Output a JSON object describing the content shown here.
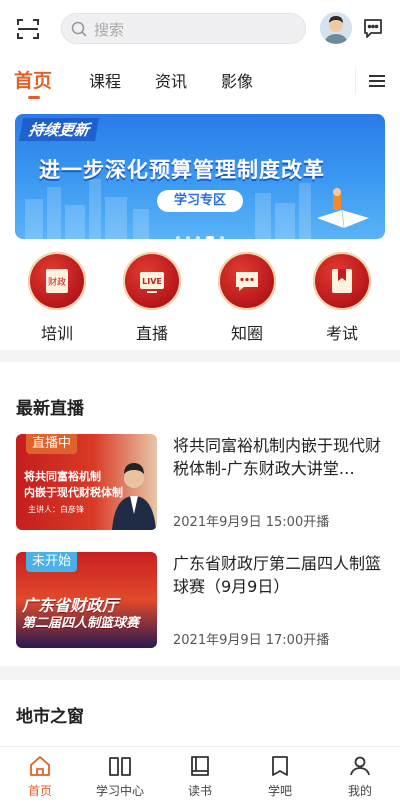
{
  "header": {
    "scan_icon": "scan-icon",
    "search_placeholder": "搜索",
    "message_icon": "message-icon"
  },
  "tabs": [
    {
      "label": "首页",
      "active": true
    },
    {
      "label": "课程",
      "active": false
    },
    {
      "label": "资讯",
      "active": false
    },
    {
      "label": "影像",
      "active": false
    }
  ],
  "banner": {
    "tag": "持续更新",
    "headline": "进一步深化预算管理制度改革",
    "button": "学习专区",
    "slide_count": 5,
    "active_slide": 4
  },
  "quick_links": [
    {
      "label": "培训",
      "icon": "finance-book-icon"
    },
    {
      "label": "直播",
      "icon": "live-tv-icon"
    },
    {
      "label": "知圈",
      "icon": "chat-bubble-icon"
    },
    {
      "label": "考试",
      "icon": "exam-bookmark-icon"
    }
  ],
  "live": {
    "title": "最新直播",
    "items": [
      {
        "badge": "直播中",
        "thumb_lines": [
          "将共同富裕机制",
          "内嵌于现代财税体制",
          "主讲人：白彦锋"
        ],
        "title": "将共同富裕机制内嵌于现代财税体制-广东财政大讲堂…",
        "time": "2021年9月9日 15:00开播"
      },
      {
        "badge": "未开始",
        "thumb_lines": [
          "广东省财政厅",
          "第二届四人制篮球赛"
        ],
        "title": "广东省财政厅第二届四人制篮球赛（9月9日）",
        "time": "2021年9月9日 17:00开播"
      }
    ]
  },
  "city": {
    "title": "地市之窗"
  },
  "bottom_nav": [
    {
      "label": "首页",
      "active": true
    },
    {
      "label": "学习中心",
      "active": false
    },
    {
      "label": "读书",
      "active": false
    },
    {
      "label": "学吧",
      "active": false
    },
    {
      "label": "我的",
      "active": false
    }
  ],
  "colors": {
    "accent": "#e0622a",
    "banner_blue": "#2a7be8",
    "icon_red": "#c41e1e"
  }
}
